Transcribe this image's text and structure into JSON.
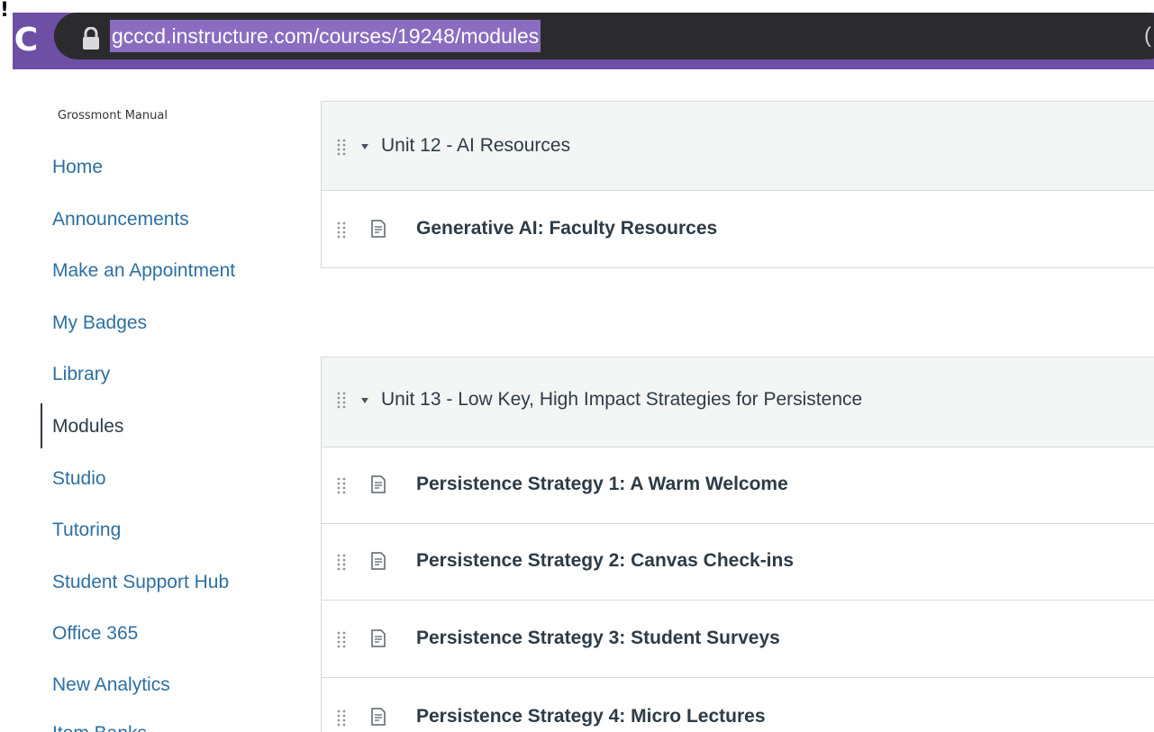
{
  "browser": {
    "reload_glyph": "C",
    "corner_glyph": "!",
    "url": "gcccd.instructure.com/courses/19248/modules",
    "url_trailing_glyph": "(",
    "accent_color": "#6d4fa6"
  },
  "course": {
    "name": "Grossmont Manual"
  },
  "nav": {
    "active": "Modules",
    "items": [
      {
        "label": "Home"
      },
      {
        "label": "Announcements"
      },
      {
        "label": "Make an Appointment"
      },
      {
        "label": "My Badges"
      },
      {
        "label": "Library"
      },
      {
        "label": "Modules"
      },
      {
        "label": "Studio"
      },
      {
        "label": "Tutoring"
      },
      {
        "label": "Student Support Hub"
      },
      {
        "label": "Office 365"
      },
      {
        "label": "New Analytics"
      },
      {
        "label": "Item Banks"
      }
    ]
  },
  "modules": [
    {
      "title": "Unit 12 - AI Resources",
      "items": [
        {
          "title": "Generative AI: Faculty Resources",
          "icon": "page-icon"
        }
      ]
    },
    {
      "title": "Unit 13 - Low Key, High Impact Strategies for Persistence",
      "items": [
        {
          "title": "Persistence Strategy 1: A Warm Welcome",
          "icon": "page-icon"
        },
        {
          "title": "Persistence Strategy 2: Canvas Check-ins",
          "icon": "page-icon"
        },
        {
          "title": "Persistence Strategy 3: Student Surveys",
          "icon": "page-icon"
        },
        {
          "title": "Persistence Strategy 4: Micro Lectures",
          "icon": "page-icon"
        }
      ]
    }
  ]
}
